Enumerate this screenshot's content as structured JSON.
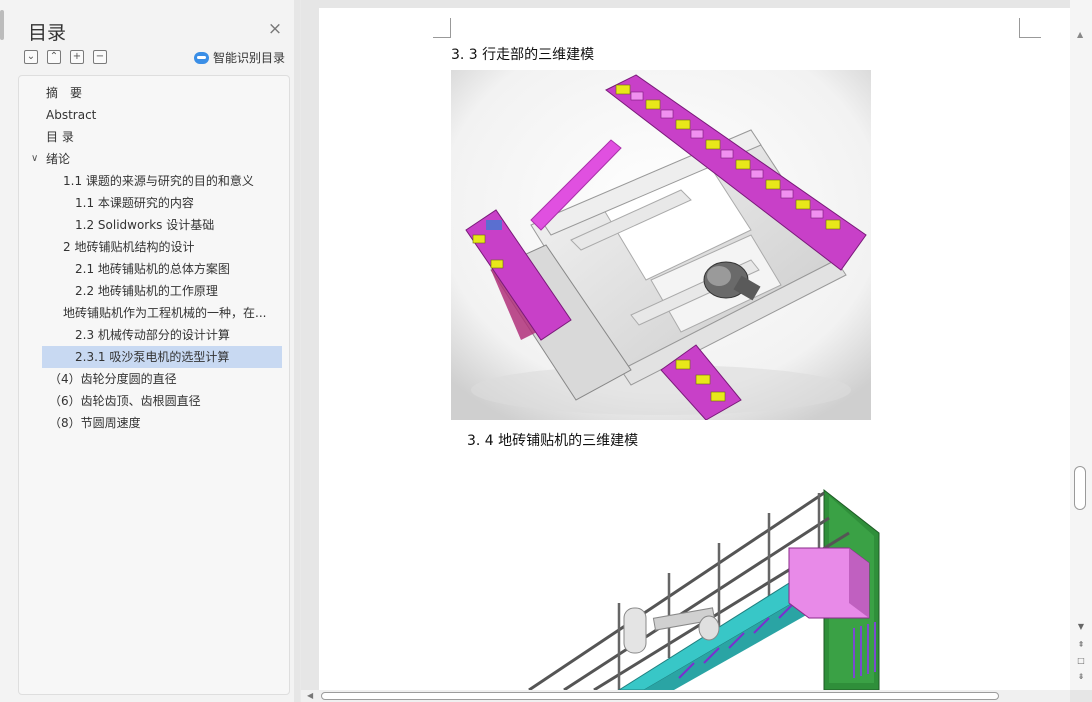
{
  "toc": {
    "title": "目录",
    "close_icon": "×",
    "tools": {
      "collapse_all": "⌄",
      "expand_all": "⌃",
      "add": "+",
      "remove": "−"
    },
    "smart_label": "智能识别目录",
    "items": [
      {
        "label": "摘　要",
        "level": "lvl0"
      },
      {
        "label": "Abstract",
        "level": "lvl0"
      },
      {
        "label": "目 录",
        "level": "lvl0"
      },
      {
        "label": "绪论",
        "level": "lvl0",
        "caret": "∨"
      },
      {
        "label": "1.1  课题的来源与研究的目的和意义",
        "level": "lvl1"
      },
      {
        "label": "1.1 本课题研究的内容",
        "level": "lvl2"
      },
      {
        "label": "1.2 Solidworks 设计基础",
        "level": "lvl2"
      },
      {
        "label": "2  地砖铺贴机结构的设计",
        "level": "lvl1"
      },
      {
        "label": "2.1  地砖铺贴机的总体方案图",
        "level": "lvl2"
      },
      {
        "label": "2.2  地砖铺贴机的工作原理",
        "level": "lvl2"
      },
      {
        "label": "地砖铺贴机作为工程机械的一种，在...",
        "level": "lvl1"
      },
      {
        "label": "2.3  机械传动部分的设计计算",
        "level": "lvl2"
      },
      {
        "label": "2.3.1 吸沙泵电机的选型计算",
        "level": "lvl2",
        "selected": true
      },
      {
        "label": "（4）齿轮分度圆的直径",
        "level": "lvlb"
      },
      {
        "label": "（6）齿轮齿顶、齿根圆直径",
        "level": "lvlb"
      },
      {
        "label": "（8）节圆周速度",
        "level": "lvlb"
      }
    ]
  },
  "document": {
    "heading_1": "3. 3  行走部的三维建模",
    "heading_2": "3. 4 地砖铺贴机的三维建模"
  },
  "scroll": {
    "up": "▲",
    "down_small": "▼",
    "page_up": "⇞",
    "dot": "□",
    "page_down": "⇟",
    "left": "◀"
  },
  "colors": {
    "selection": "#c8d9f2",
    "accent": "#3a8ee6",
    "track_magenta": "#e040e0",
    "track_yellow": "#e8e81a",
    "frame_green": "#2f8f3a",
    "frame_cyan": "#38c7c7"
  }
}
